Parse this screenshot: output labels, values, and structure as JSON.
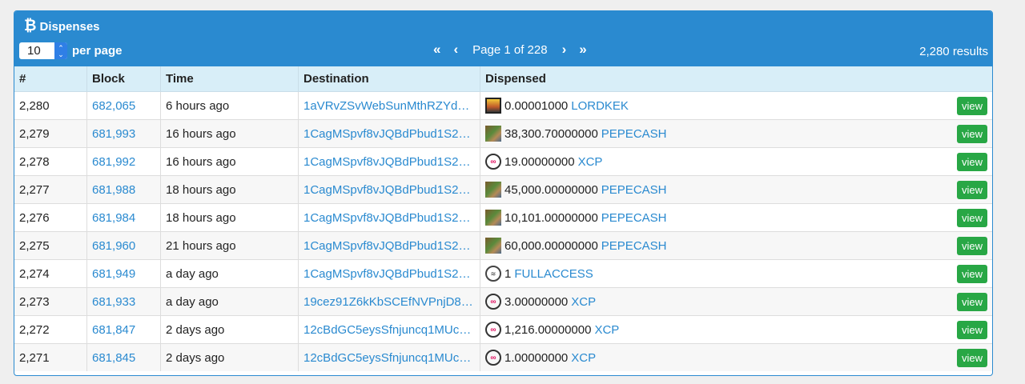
{
  "header": {
    "title": "Dispenses",
    "per_page_value": "10",
    "per_page_label": "per page",
    "page_text": "Page 1 of 228",
    "results_text": "2,280 results"
  },
  "columns": [
    "#",
    "Block",
    "Time",
    "Destination",
    "Dispensed"
  ],
  "view_label": "view",
  "rows": [
    {
      "num": "2,280",
      "block": "682,065",
      "time": "6 hours ago",
      "dest": "1aVRvZSvWebSunMthRZYd…",
      "amount": "0.00001000",
      "asset": "LORDKEK",
      "icon": "lordkek-icon"
    },
    {
      "num": "2,279",
      "block": "681,993",
      "time": "16 hours ago",
      "dest": "1CagMSpvf8vJQBdPbud1S2…",
      "amount": "38,300.70000000",
      "asset": "PEPECASH",
      "icon": "pepecash-icon"
    },
    {
      "num": "2,278",
      "block": "681,992",
      "time": "16 hours ago",
      "dest": "1CagMSpvf8vJQBdPbud1S2…",
      "amount": "19.00000000",
      "asset": "XCP",
      "icon": "xcp-icon"
    },
    {
      "num": "2,277",
      "block": "681,988",
      "time": "18 hours ago",
      "dest": "1CagMSpvf8vJQBdPbud1S2…",
      "amount": "45,000.00000000",
      "asset": "PEPECASH",
      "icon": "pepecash-icon"
    },
    {
      "num": "2,276",
      "block": "681,984",
      "time": "18 hours ago",
      "dest": "1CagMSpvf8vJQBdPbud1S2…",
      "amount": "10,101.00000000",
      "asset": "PEPECASH",
      "icon": "pepecash-icon"
    },
    {
      "num": "2,275",
      "block": "681,960",
      "time": "21 hours ago",
      "dest": "1CagMSpvf8vJQBdPbud1S2…",
      "amount": "60,000.00000000",
      "asset": "PEPECASH",
      "icon": "pepecash-icon"
    },
    {
      "num": "2,274",
      "block": "681,949",
      "time": "a day ago",
      "dest": "1CagMSpvf8vJQBdPbud1S2…",
      "amount": "1",
      "asset": "FULLACCESS",
      "icon": "fullaccess-icon"
    },
    {
      "num": "2,273",
      "block": "681,933",
      "time": "a day ago",
      "dest": "19cez91Z6kKbSCEfNVPnjD8…",
      "amount": "3.00000000",
      "asset": "XCP",
      "icon": "xcp-icon"
    },
    {
      "num": "2,272",
      "block": "681,847",
      "time": "2 days ago",
      "dest": "12cBdGC5eysSfnjuncq1MUc…",
      "amount": "1,216.00000000",
      "asset": "XCP",
      "icon": "xcp-icon"
    },
    {
      "num": "2,271",
      "block": "681,845",
      "time": "2 days ago",
      "dest": "12cBdGC5eysSfnjuncq1MUc…",
      "amount": "1.00000000",
      "asset": "XCP",
      "icon": "xcp-icon"
    }
  ]
}
